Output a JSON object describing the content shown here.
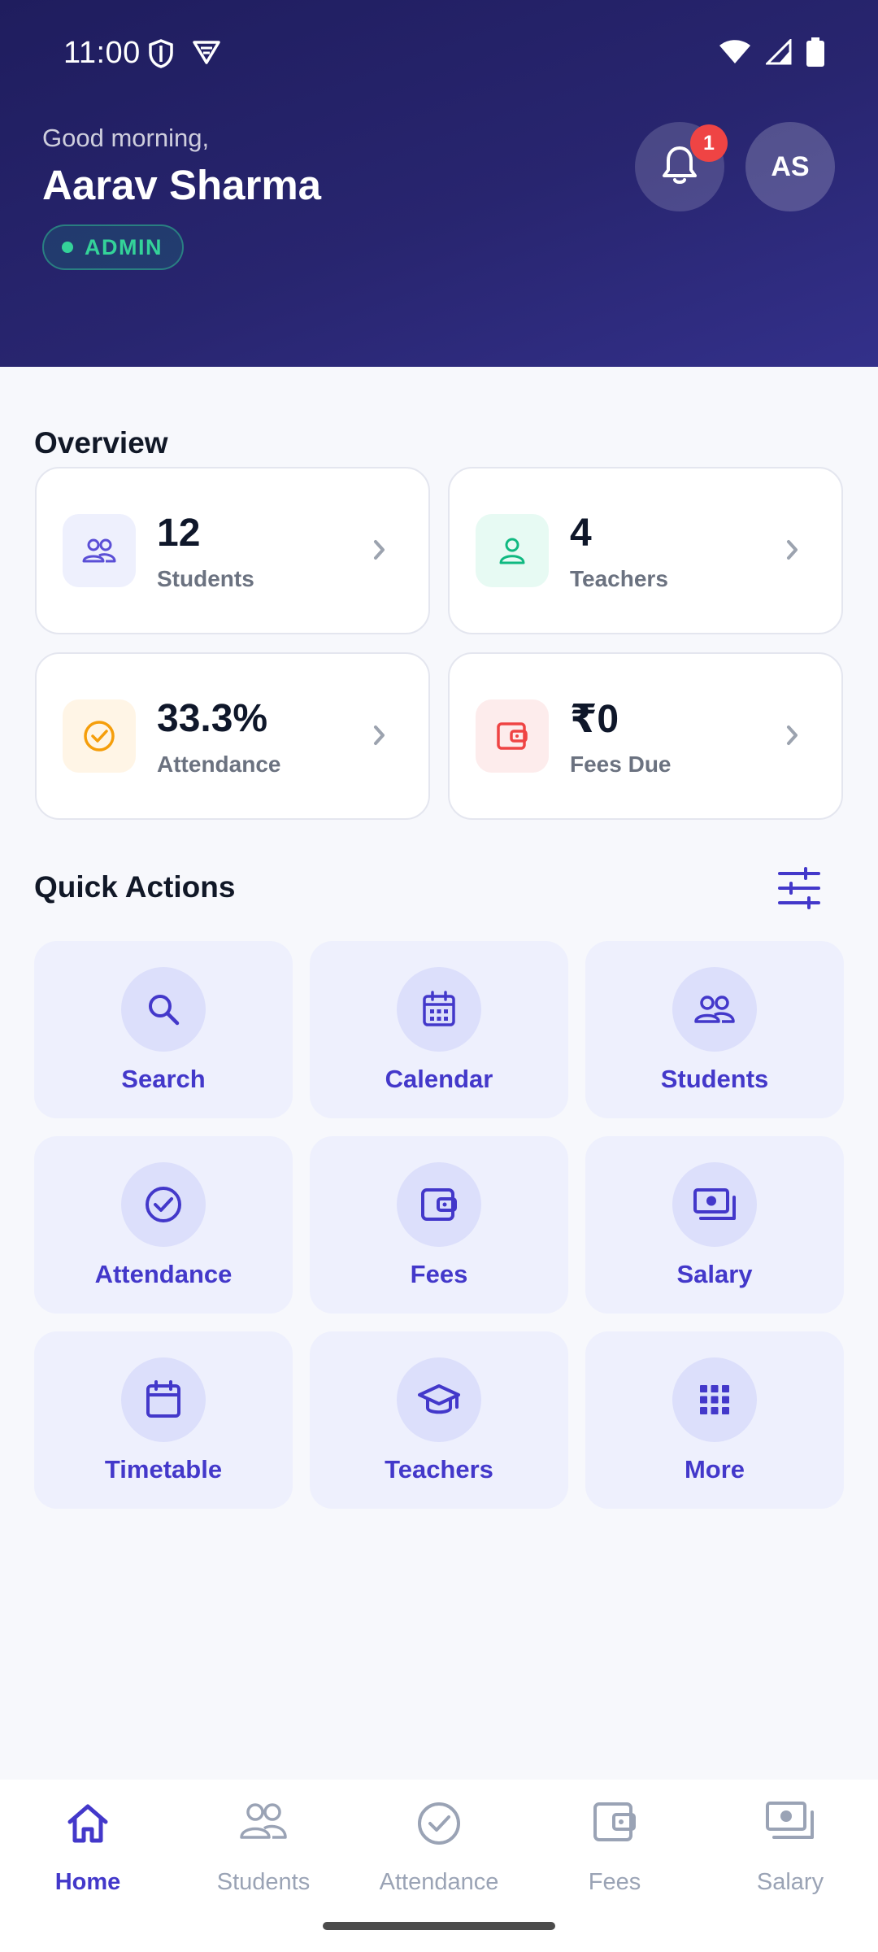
{
  "status_bar": {
    "time": "11:00"
  },
  "header": {
    "greeting": "Good morning,",
    "user_name": "Aarav Sharma",
    "role": "ADMIN",
    "notification_count": "1",
    "avatar_initials": "AS"
  },
  "overview": {
    "title": "Overview",
    "cards": [
      {
        "value": "12",
        "label": "Students",
        "icon": "students-icon",
        "color": "#5b4fd6",
        "bg": "#eef0fd"
      },
      {
        "value": "4",
        "label": "Teachers",
        "icon": "teacher-icon",
        "color": "#10b981",
        "bg": "#e7faf3"
      },
      {
        "value": "33.3%",
        "label": "Attendance",
        "icon": "check-circle-icon",
        "color": "#f59e0b",
        "bg": "#fff5e6"
      },
      {
        "value": "₹0",
        "label": "Fees Due",
        "icon": "wallet-icon",
        "color": "#ef4444",
        "bg": "#fdecec"
      }
    ]
  },
  "quick_actions": {
    "title": "Quick Actions",
    "items": [
      {
        "label": "Search",
        "icon": "search-icon"
      },
      {
        "label": "Calendar",
        "icon": "calendar-icon"
      },
      {
        "label": "Students",
        "icon": "students-icon"
      },
      {
        "label": "Attendance",
        "icon": "check-circle-icon"
      },
      {
        "label": "Fees",
        "icon": "wallet-icon"
      },
      {
        "label": "Salary",
        "icon": "money-icon"
      },
      {
        "label": "Timetable",
        "icon": "timetable-icon"
      },
      {
        "label": "Teachers",
        "icon": "graduation-cap-icon"
      },
      {
        "label": "More",
        "icon": "grid-icon"
      }
    ]
  },
  "bottom_nav": {
    "items": [
      {
        "label": "Home",
        "icon": "home-icon",
        "active": true
      },
      {
        "label": "Students",
        "icon": "students-icon",
        "active": false
      },
      {
        "label": "Attendance",
        "icon": "check-circle-icon",
        "active": false
      },
      {
        "label": "Fees",
        "icon": "wallet-icon",
        "active": false
      },
      {
        "label": "Salary",
        "icon": "money-icon",
        "active": false
      }
    ]
  },
  "colors": {
    "accent": "#4338ca",
    "header_gradient_start": "#1f1d5e",
    "header_gradient_end": "#33308a",
    "admin_badge": "#34d399",
    "notification_badge": "#ef4444",
    "nav_inactive": "#9aa3b5"
  }
}
